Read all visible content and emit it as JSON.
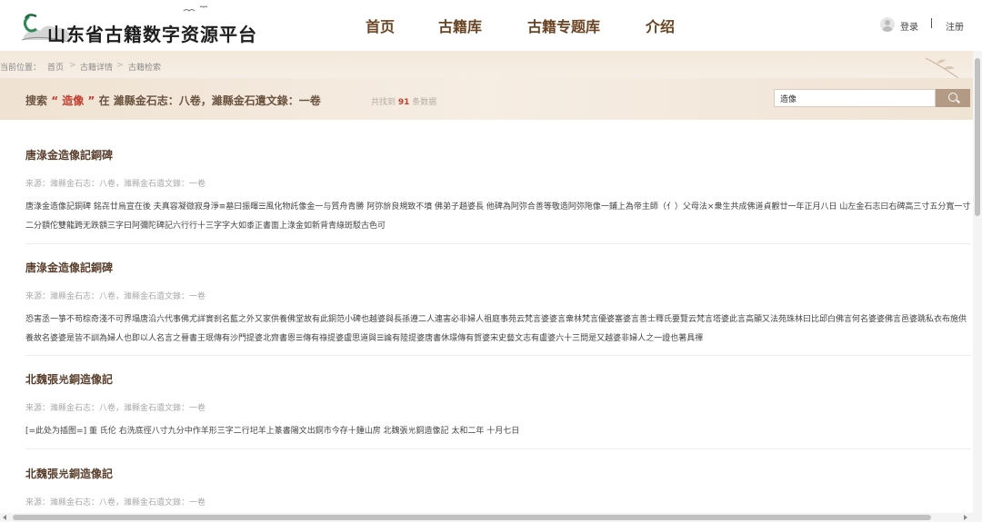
{
  "site": {
    "title": "山东省古籍数字资源平台"
  },
  "nav": {
    "items": [
      {
        "label": "首页"
      },
      {
        "label": "古籍库"
      },
      {
        "label": "古籍专题库"
      },
      {
        "label": "介绍"
      }
    ]
  },
  "user": {
    "login_label": "登录",
    "separator": "|",
    "register_label": "注册"
  },
  "breadcrumb": {
    "prefix": "当前位置：",
    "items": [
      "首页",
      "古籍详情",
      "古籍检索"
    ],
    "separator": ">"
  },
  "search": {
    "title_prefix": "搜索",
    "quote_open": "“",
    "keyword": "造像",
    "quote_close": "”",
    "title_mid": "在",
    "scope": "濰縣金石志：八卷，濰縣金石遺文錄：一卷",
    "count_prefix": "共找到",
    "count": "91",
    "count_suffix": "条数据",
    "input_value": "造像"
  },
  "results": [
    {
      "title": "唐淥金造像記銅碑",
      "source": "来源：濰縣金石志：八卷，濰縣金石遺文錄：一卷",
      "text": "唐淥金造像記銅碑 銘㐂廿烏宣在後 夫真容凝㣲寂身淨≡墓曰振暉☰風化物託像金一与質舟青勝 阿弥㫅良規致不墳 佛弟子趙婆長 他碑為阿弥合善等敬造阿弥陁像一鋪上為帝主師（亻）父母法⨯衆生共成佛道貞觀廿一年正月八日 山左金石志曰右碑高三寸五分寬一寸二分額佗雙龍跨无跌額三字曰阿彌陀碑記六行行十三字字大如黍正書面上淥金如新背青綠斑駁古色可"
    },
    {
      "title": "唐淥金造像記銅碑",
      "source": "来源：濰縣金石志：八卷，濰縣金石遺文錄：一卷",
      "text": "恐害丞一箏不苟棕奇淺不可界塌唐沿六代事佛尤詳實刹名藍之外又家供養佛堂故有此銅范小碑也越婆與長孫遵二人連害必非婦人祖庭事苑云梵言婆婆言衆林梵言優婆塞婆言善士釋氏要覽云梵言塔婆此言高顯又法苑珠林曰比邱白佛言何名婆婆佛言邑婆跳私衣布施供養故名婆婆是皆不訓為婦人也即以人名言之晉書王珉傳有沙門提婆北齊書恩☰傳有祿提婆盧思道與☰論有陸提婆唐書休璟傳有賀婆宋史藝文志有盧婆六十三問是又越婆非婦人之一證也著具禪"
    },
    {
      "title": "北魏張𡵉銅造像記",
      "source": "来源：濰縣金石志：八卷，濰縣金石遺文錄：一卷",
      "text": "[=此处为插图=] 董 氏伦 右洗底徑八寸九分中作羊形三字二行𡉏羊上篆書陽文出銅市今存十鍾山房 北魏張𡵉銅造像記 太和二年 十月七日"
    },
    {
      "title": "北魏張𡵉銅造像記",
      "source": "来源：濰縣金石志：八卷，濰縣金石遺文錄：一卷",
      "text": ""
    }
  ]
}
